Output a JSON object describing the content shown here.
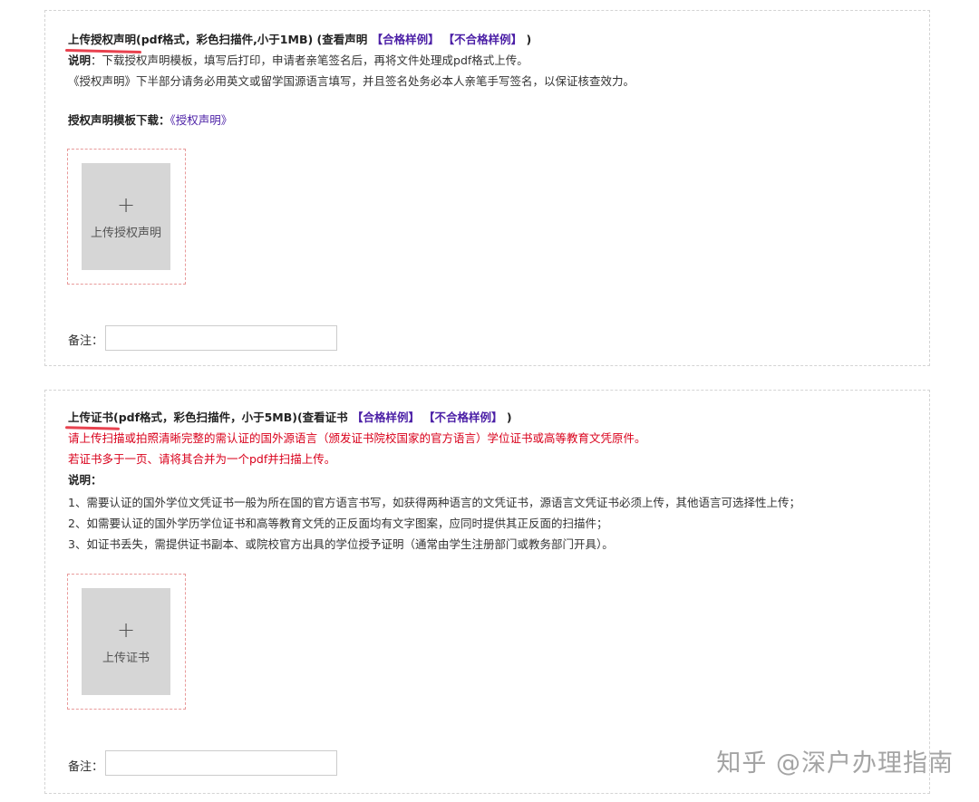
{
  "section1": {
    "title": {
      "main": "上传授权声明",
      "spec": "(pdf格式，彩色扫描件,小于1MB) (查看声明 ",
      "link_ok": "【合格样例】",
      "sep": " ",
      "link_bad": "【不合格样例】",
      "close": " )"
    },
    "desc_label": "说明",
    "desc_text": "：下载授权声明模板，填写后打印，申请者亲笔签名后，再将文件处理成pdf格式上传。",
    "desc_line2": "《授权声明》下半部分请务必用英文或留学国源语言填写，并且签名处务必本人亲笔手写签名，以保证核查效力。",
    "template_label": "授权声明模板下载：",
    "template_link": "《授权声明》",
    "upload_plus": "+",
    "upload_label": "上传授权声明",
    "remark_label": "备注：",
    "remark_value": ""
  },
  "section2": {
    "title": {
      "main": "上传证书",
      "spec": "(pdf格式，彩色扫描件，小于5MB)(查看证书 ",
      "link_ok": "【合格样例】",
      "sep": " ",
      "link_bad": "【不合格样例】",
      "close": " )"
    },
    "red_line1": "请上传扫描或拍照清晰完整的需认证的国外源语言（颁发证书院校国家的官方语言）学位证书或高等教育文凭原件。",
    "red_line2": "若证书多于一页、请将其合并为一个pdf并扫描上传。",
    "desc_label": "说明：",
    "items": [
      "1、需要认证的国外学位文凭证书一般为所在国的官方语言书写，如获得两种语言的文凭证书，源语言文凭证书必须上传，其他语言可选择性上传；",
      "2、如需要认证的国外学历学位证书和高等教育文凭的正反面均有文字图案，应同时提供其正反面的扫描件；",
      "3、如证书丢失，需提供证书副本、或院校官方出具的学位授予证明（通常由学生注册部门或教务部门开具）。"
    ],
    "upload_plus": "+",
    "upload_label": "上传证书",
    "remark_label": "备注：",
    "remark_value": ""
  },
  "watermark": "知乎 @深户办理指南",
  "colors": {
    "link": "#4b1fa6",
    "warning": "#d9001b",
    "upload_box": "#d6d6d6",
    "upload_frame_border": "#e89a9a",
    "highlight_underline": "#e8424f"
  }
}
